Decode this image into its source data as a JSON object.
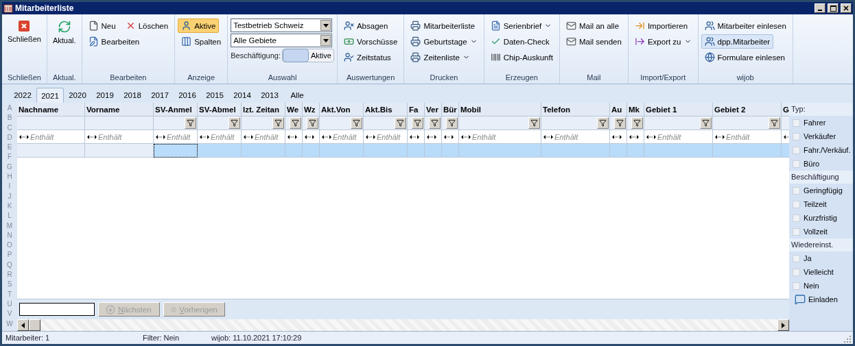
{
  "window": {
    "title": "Mitarbeiterliste"
  },
  "ribbon": {
    "groups": [
      {
        "kind": "large",
        "label": "Schließen",
        "buttons": [
          {
            "label": "Schließen"
          }
        ]
      },
      {
        "kind": "large",
        "label": "Aktual.",
        "buttons": [
          {
            "label": "Aktual."
          }
        ]
      },
      {
        "kind": "small",
        "label": "Bearbeiten",
        "rows": [
          [
            {
              "label": "Neu"
            },
            {
              "label": "Löschen"
            }
          ],
          [
            {
              "label": "Bearbeiten"
            }
          ]
        ]
      },
      {
        "kind": "small",
        "label": "Anzeige",
        "rows": [
          [
            {
              "label": "Aktive",
              "selected": true
            }
          ],
          [
            {
              "label": "Spalten",
              "selected": false
            }
          ]
        ]
      },
      {
        "kind": "selection",
        "label": "Auswahl",
        "dropdowns": [
          "Testbetrieb Schweiz",
          "Alle Gebiete"
        ],
        "employment": {
          "label": "Beschäftigung:",
          "value": "Aktive",
          "on": true
        }
      },
      {
        "kind": "small",
        "label": "Auswertungen",
        "rows": [
          [
            {
              "label": "Absagen"
            }
          ],
          [
            {
              "label": "Vorschüsse"
            }
          ],
          [
            {
              "label": "Zeitstatus"
            }
          ]
        ]
      },
      {
        "kind": "small",
        "label": "Drucken",
        "rows": [
          [
            {
              "label": "Mitarbeiterliste"
            }
          ],
          [
            {
              "label": "Geburtstage",
              "menu": true
            }
          ],
          [
            {
              "label": "Zeitenliste",
              "menu": true
            }
          ]
        ]
      },
      {
        "kind": "small",
        "label": "Erzeugen",
        "rows": [
          [
            {
              "label": "Serienbrief",
              "menu": true
            }
          ],
          [
            {
              "label": "Daten-Check"
            }
          ],
          [
            {
              "label": "Chip-Auskunft"
            }
          ]
        ]
      },
      {
        "kind": "small",
        "label": "Mail",
        "rows": [
          [
            {
              "label": "Mail an alle"
            }
          ],
          [
            {
              "label": "Mail senden"
            }
          ]
        ]
      },
      {
        "kind": "small",
        "label": "Import/Export",
        "rows": [
          [
            {
              "label": "Importieren"
            }
          ],
          [
            {
              "label": "Export zu",
              "menu": true
            }
          ]
        ]
      },
      {
        "kind": "small",
        "label": "wijob",
        "rows": [
          [
            {
              "label": "Mitarbeiter einlesen",
              "hovered": false
            }
          ],
          [
            {
              "label": "dpp.Mitarbeiter",
              "hovered": true
            }
          ],
          [
            {
              "label": "Formulare einlesen",
              "hovered": false
            }
          ]
        ]
      }
    ]
  },
  "year_tabs": [
    {
      "label": "2022",
      "selected": false
    },
    {
      "label": "2021",
      "selected": true
    },
    {
      "label": "2020",
      "selected": false
    },
    {
      "label": "2019",
      "selected": false
    },
    {
      "label": "2018",
      "selected": false
    },
    {
      "label": "2017",
      "selected": false
    },
    {
      "label": "2016",
      "selected": false
    },
    {
      "label": "2015",
      "selected": false
    },
    {
      "label": "2014",
      "selected": false
    },
    {
      "label": "2013",
      "selected": false
    },
    {
      "label": "Alle",
      "selected": false
    }
  ],
  "index_letters": [
    "A",
    "B",
    "C",
    "D",
    "E",
    "F",
    "G",
    "H",
    "I",
    "J",
    "K",
    "L",
    "M",
    "N",
    "O",
    "P",
    "Q",
    "R",
    "S",
    "T",
    "U",
    "V",
    "W"
  ],
  "table": {
    "columns": [
      {
        "label": "Nachname",
        "filter": false,
        "hint": "Enthält",
        "frozen": true,
        "focused": false
      },
      {
        "label": "Vorname",
        "filter": false,
        "hint": "Enthält",
        "frozen": true,
        "focused": false
      },
      {
        "label": "SV-Anmel",
        "filter": true,
        "hint": "Enthält",
        "frozen": false,
        "focused": true
      },
      {
        "label": "SV-Abmel",
        "filter": true,
        "hint": "Enthält",
        "frozen": false,
        "focused": false
      },
      {
        "label": "lzt. Zeitan",
        "filter": true,
        "hint": "Enthält",
        "frozen": false,
        "focused": false
      },
      {
        "label": "We",
        "filter": true,
        "frozen": false,
        "focused": false
      },
      {
        "label": "Wz",
        "filter": true,
        "frozen": false,
        "focused": false
      },
      {
        "label": "Akt.Von",
        "filter": true,
        "hint": "Enthält",
        "frozen": false,
        "focused": false
      },
      {
        "label": "Akt.Bis",
        "filter": true,
        "hint": "Enthält",
        "frozen": false,
        "focused": false
      },
      {
        "label": "Fa",
        "filter": true,
        "frozen": false,
        "focused": false
      },
      {
        "label": "Ver",
        "filter": true,
        "frozen": false,
        "focused": false
      },
      {
        "label": "Bür",
        "filter": true,
        "frozen": false,
        "focused": false
      },
      {
        "label": "Mobil",
        "filter": true,
        "hint": "Enthält",
        "frozen": false,
        "focused": false
      },
      {
        "label": "Telefon",
        "filter": true,
        "hint": "Enthält",
        "frozen": false,
        "focused": false
      },
      {
        "label": "Au",
        "filter": true,
        "frozen": false,
        "focused": false
      },
      {
        "label": "Mk",
        "filter": true,
        "frozen": false,
        "focused": false
      },
      {
        "label": "Gebiet 1",
        "filter": true,
        "hint": "Enthält",
        "frozen": false,
        "focused": false
      },
      {
        "label": "Gebiet 2",
        "filter": true,
        "hint": "Enthält",
        "frozen": false,
        "focused": false
      },
      {
        "label": "G",
        "frozen": false,
        "focused": false
      }
    ],
    "row_selected": true
  },
  "search": {
    "buttons": [
      {
        "label": "Nächsten",
        "disabled": true
      },
      {
        "label": "Vorherigen",
        "disabled": true
      }
    ]
  },
  "side_panel": {
    "sections": [
      {
        "title": "Typ:",
        "items": [
          {
            "label": "Fahrer",
            "checked": false
          },
          {
            "label": "Verkäufer",
            "checked": false
          },
          {
            "label": "Fahr./Verkäuf.",
            "checked": false
          },
          {
            "label": "Büro",
            "checked": false
          }
        ]
      },
      {
        "title": "Beschäftigung",
        "items": [
          {
            "label": "Geringfügig",
            "checked": false
          },
          {
            "label": "Teilzeit",
            "checked": false
          },
          {
            "label": "Kurzfristig",
            "checked": false
          },
          {
            "label": "Vollzeit",
            "checked": false
          }
        ]
      },
      {
        "title": "Wiedereinst.",
        "items": [
          {
            "label": "Ja",
            "checked": false
          },
          {
            "label": "Vielleicht",
            "checked": false
          },
          {
            "label": "Nein",
            "checked": false
          }
        ]
      }
    ],
    "action": "Einladen"
  },
  "status_bar": [
    "Mitarbeiter: 1",
    "Filter: Nein",
    "wijob: 11.10.2021 17:10:29"
  ]
}
